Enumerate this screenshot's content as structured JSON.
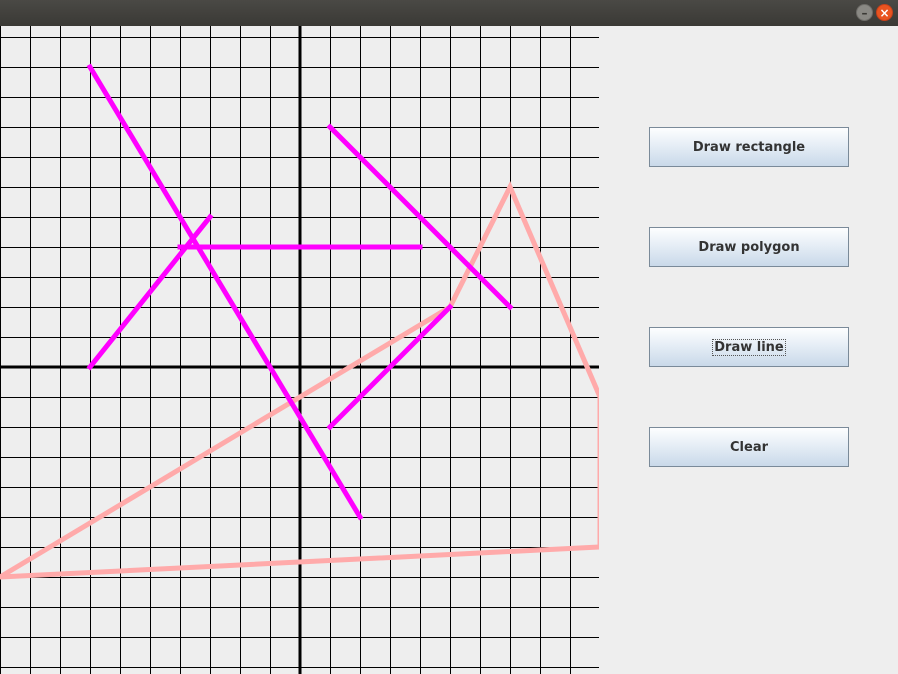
{
  "window": {
    "minimize_glyph": "–",
    "close_glyph": "×"
  },
  "buttons": {
    "draw_rectangle": "Draw rectangle",
    "draw_polygon": "Draw polygon",
    "draw_line": "Draw line",
    "clear": "Clear"
  },
  "colors": {
    "line": "#ff00ff",
    "polygon": "#ffaaaa",
    "grid": "#000000",
    "background": "#eeeeee"
  },
  "grid": {
    "cell_units": 1
  },
  "shapes": {
    "lines": [
      {
        "from": [
          -7,
          10
        ],
        "to": [
          2,
          -5
        ]
      },
      {
        "from": [
          1,
          8
        ],
        "to": [
          7,
          2
        ]
      },
      {
        "from": [
          -4,
          4
        ],
        "to": [
          4,
          4
        ]
      },
      {
        "from": [
          -7,
          0
        ],
        "to": [
          -3,
          5
        ]
      },
      {
        "from": [
          1,
          -2
        ],
        "to": [
          5,
          2
        ]
      }
    ],
    "polygon": [
      [
        -10,
        -7
      ],
      [
        5,
        2
      ],
      [
        7,
        6
      ],
      [
        10,
        -1
      ],
      [
        10,
        -6
      ]
    ]
  }
}
